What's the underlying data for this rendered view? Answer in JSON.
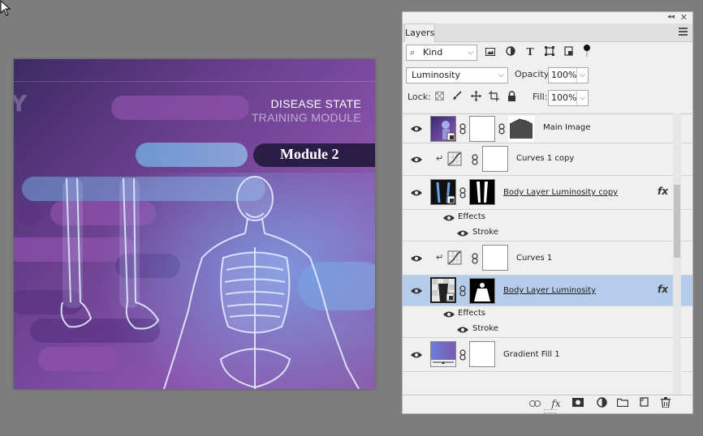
{
  "canvas": {
    "title_line1": "DISEASE STATE",
    "title_line2": "TRAINING MODULE",
    "module_label": "Module 2",
    "partial_letter": "Y"
  },
  "panel": {
    "tab_label": "Layers",
    "collapse_icon": "double-chevron-left-icon",
    "close_icon": "close-icon",
    "filter": {
      "value": "Kind",
      "icons": [
        "image-filter-icon",
        "adjustment-filter-icon",
        "type-filter-icon",
        "shape-filter-icon",
        "smart-object-filter-icon",
        "filter-toggle-dot"
      ]
    },
    "blend_mode": {
      "value": "Luminosity"
    },
    "opacity": {
      "label": "Opacity:",
      "value": "100%"
    },
    "lock": {
      "label": "Lock:",
      "icons": [
        "lock-transparent-icon",
        "lock-paint-icon",
        "lock-position-icon",
        "lock-artboard-icon",
        "lock-all-icon"
      ]
    },
    "fill": {
      "label": "Fill:",
      "value": "100%"
    },
    "layers": [
      {
        "name": "Main Image",
        "selected": false,
        "has_fx": false
      },
      {
        "name": "Curves 1 copy",
        "selected": false,
        "clipped": true,
        "has_fx": false
      },
      {
        "name": "Body Layer Luminosity copy",
        "selected": false,
        "has_fx": true,
        "fx_label": "fx",
        "effects_label": "Effects",
        "stroke_label": "Stroke"
      },
      {
        "name": "Curves 1",
        "selected": false,
        "clipped": true,
        "has_fx": false
      },
      {
        "name": "Body Layer Luminosity",
        "selected": true,
        "has_fx": true,
        "fx_label": "fx",
        "effects_label": "Effects",
        "stroke_label": "Stroke"
      },
      {
        "name": "Gradient Fill 1",
        "selected": false,
        "has_fx": false
      }
    ],
    "bottom_tools": {
      "link": "link-layers-icon",
      "fx": "fx",
      "mask": "add-mask-icon",
      "adjust": "new-adjustment-icon",
      "group": "new-group-icon",
      "new": "new-layer-icon",
      "delete": "trash-icon"
    }
  },
  "colors": {
    "selected_row": "#b5cdea",
    "panel_bg": "#f0f0f0",
    "workspace_bg": "#7d7d7d",
    "canvas_purple": "#6a3f8e"
  }
}
